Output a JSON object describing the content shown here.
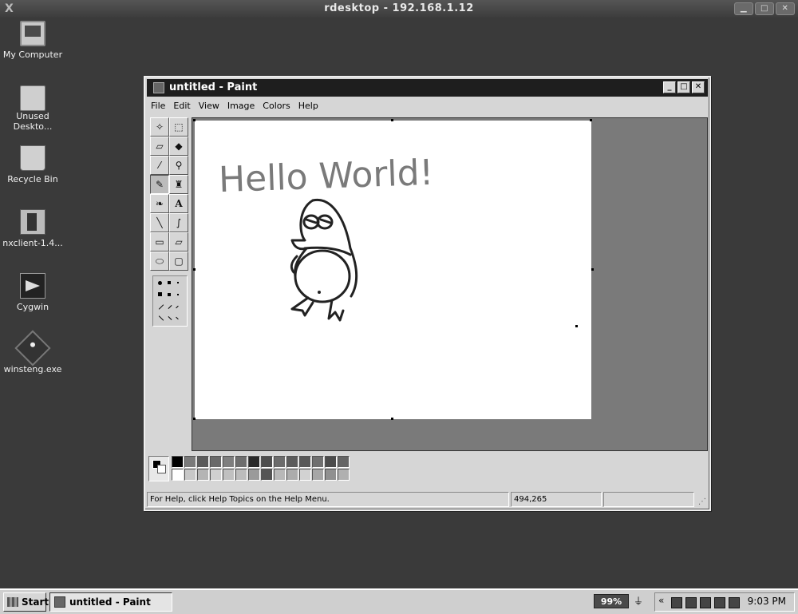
{
  "outer_window": {
    "title": "rdesktop - 192.168.1.12",
    "close_glyph": "X"
  },
  "desktop_icons": [
    {
      "label": "My Computer",
      "icon": "computer-icon"
    },
    {
      "label": "Unused Deskto...",
      "icon": "folder-icon"
    },
    {
      "label": "Recycle Bin",
      "icon": "recycle-bin-icon"
    },
    {
      "label": "nxclient-1.4...",
      "icon": "installer-icon"
    },
    {
      "label": "Cygwin",
      "icon": "cygwin-icon"
    },
    {
      "label": "winsteng.exe",
      "icon": "executable-icon"
    }
  ],
  "paint": {
    "title": "untitled - Paint",
    "menu": [
      "File",
      "Edit",
      "View",
      "Image",
      "Colors",
      "Help"
    ],
    "tools": [
      "free-form-select-icon",
      "select-icon",
      "eraser-icon",
      "fill-icon",
      "pick-color-icon",
      "magnifier-icon",
      "pencil-icon",
      "brush-icon",
      "airbrush-icon",
      "text-icon",
      "line-icon",
      "curve-icon",
      "rectangle-icon",
      "polygon-icon",
      "ellipse-icon",
      "rounded-rectangle-icon"
    ],
    "text_tool_glyph": "A",
    "canvas_text": "Hello World!",
    "colors": {
      "row1": [
        "#000000",
        "#7a7a7a",
        "#5a5a5a",
        "#6a6a6a",
        "#7f7f7f",
        "#6e6e6e",
        "#2a2a2a",
        "#4e4e4e",
        "#6c6c6c",
        "#5c5c5c",
        "#585858",
        "#707070",
        "#4c4c4c",
        "#656565"
      ],
      "row2": [
        "#ffffff",
        "#c8c8c8",
        "#b4b4b4",
        "#d0d0d0",
        "#c0c0c0",
        "#bcbcbc",
        "#9a9a9a",
        "#545454",
        "#b8b8b8",
        "#acacac",
        "#d2d2d2",
        "#a6a6a6",
        "#909090",
        "#b0b0b0"
      ]
    },
    "status": {
      "help": "For Help, click Help Topics on the Help Menu.",
      "coords": "494,265"
    }
  },
  "taskbar": {
    "start_label": "Start",
    "task_label": "untitled - Paint",
    "battery": "99%",
    "tray_arrow": "«",
    "clock": "9:03 PM"
  }
}
